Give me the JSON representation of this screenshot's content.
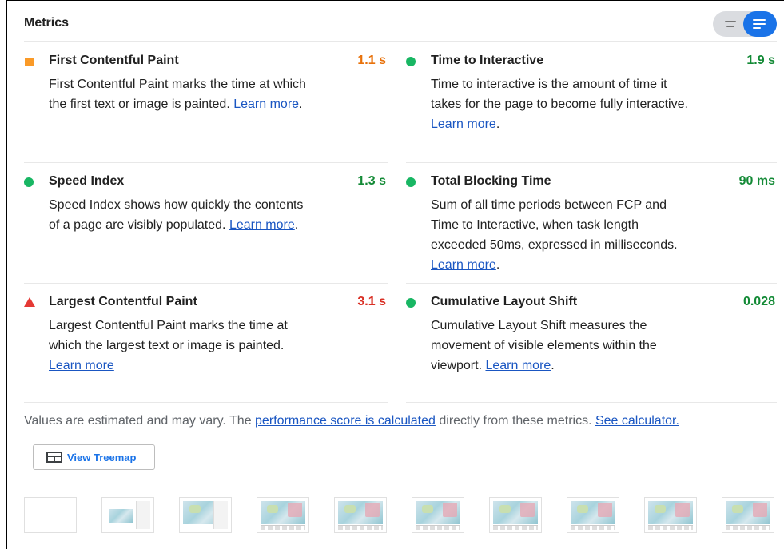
{
  "header": {
    "title": "Metrics"
  },
  "toggle": {
    "compact_icon": "compact-view-icon",
    "expanded_icon": "expanded-view-icon",
    "accent": "#1a73e8"
  },
  "metrics": [
    {
      "name": "First Contentful Paint",
      "value": "1.1 s",
      "indicator": "square",
      "status": "average",
      "desc": "First Contentful Paint marks the time at which the first text or image is painted. ",
      "link": "Learn more",
      "trail": "."
    },
    {
      "name": "Time to Interactive",
      "value": "1.9 s",
      "indicator": "circle",
      "status": "pass",
      "desc": "Time to interactive is the amount of time it takes for the page to become fully interactive. ",
      "link": "Learn more",
      "trail": "."
    },
    {
      "name": "Speed Index",
      "value": "1.3 s",
      "indicator": "circle",
      "status": "pass",
      "desc": "Speed Index shows how quickly the contents of a page are visibly populated. ",
      "link": "Learn more",
      "trail": "."
    },
    {
      "name": "Total Blocking Time",
      "value": "90 ms",
      "indicator": "circle",
      "status": "pass",
      "desc": "Sum of all time periods between FCP and Time to Interactive, when task length exceeded 50ms, expressed in milliseconds. ",
      "link": "Learn more",
      "trail": "."
    },
    {
      "name": "Largest Contentful Paint",
      "value": "3.1 s",
      "indicator": "triangle",
      "status": "fail",
      "desc": "Largest Contentful Paint marks the time at which the largest text or image is painted. ",
      "link": "Learn more",
      "trail": ""
    },
    {
      "name": "Cumulative Layout Shift",
      "value": "0.028",
      "indicator": "circle",
      "status": "pass",
      "desc": "Cumulative Layout Shift measures the movement of visible elements within the viewport. ",
      "link": "Learn more",
      "trail": "."
    }
  ],
  "footnote": {
    "prefix": "Values are estimated and may vary. The ",
    "link1": "performance score is calculated",
    "middle": " directly from these metrics. ",
    "link2": "See calculator."
  },
  "treemap_button": {
    "label": "View Treemap",
    "icon": "treemap-icon"
  },
  "colors": {
    "average": "#e8710a",
    "pass": "#138a36",
    "fail": "#d93025",
    "link": "#1a56c2"
  },
  "filmstrip_count": 10
}
